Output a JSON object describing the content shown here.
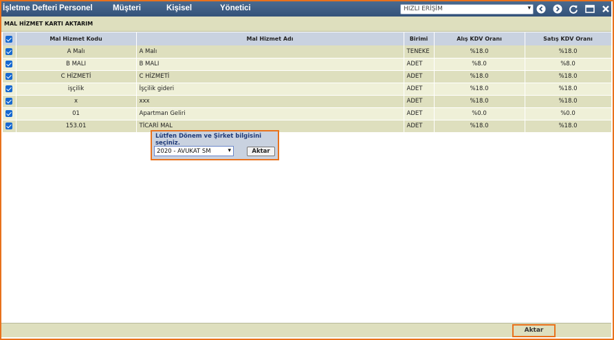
{
  "nav": {
    "items": [
      "İşletme Defteri",
      "Personel",
      "Müşteri",
      "Kişisel",
      "Yönetici"
    ],
    "quick_access": "HIZLI ERİŞİM"
  },
  "icons": [
    "back-icon",
    "forward-icon",
    "refresh-icon",
    "window-icon",
    "close-icon"
  ],
  "page_title": "MAL HİZMET KARTI AKTARIM",
  "table": {
    "headers": [
      "Mal Hizmet Kodu",
      "Mal Hizmet Adı",
      "Birimi",
      "Alış KDV Oranı",
      "Satış KDV Oranı"
    ],
    "rows": [
      [
        "A Malı",
        "A Malı",
        "TENEKE",
        "%18.0",
        "%18.0"
      ],
      [
        "B MALI",
        "B MALI",
        "ADET",
        "%8.0",
        "%8.0"
      ],
      [
        "C HİZMETİ",
        "C HİZMETİ",
        "ADET",
        "%18.0",
        "%18.0"
      ],
      [
        "işçilik",
        "İşçilik gideri",
        "ADET",
        "%18.0",
        "%18.0"
      ],
      [
        "x",
        "xxx",
        "ADET",
        "%18.0",
        "%18.0"
      ],
      [
        "01",
        "Apartman Geliri",
        "ADET",
        "%0.0",
        "%0.0"
      ],
      [
        "153.01",
        "TİCARİ MAL",
        "ADET",
        "%18.0",
        "%18.0"
      ]
    ]
  },
  "popup": {
    "message": "Lütfen Dönem ve Şirket bilgisini seçiniz.",
    "selected": "2020 - AVUKAT SM",
    "button": "Aktar"
  },
  "footer": {
    "button": "Aktar"
  },
  "colors": {
    "accent": "#e8711c",
    "header_bar": "#3e5f86",
    "checkbox": "#1769d1"
  }
}
